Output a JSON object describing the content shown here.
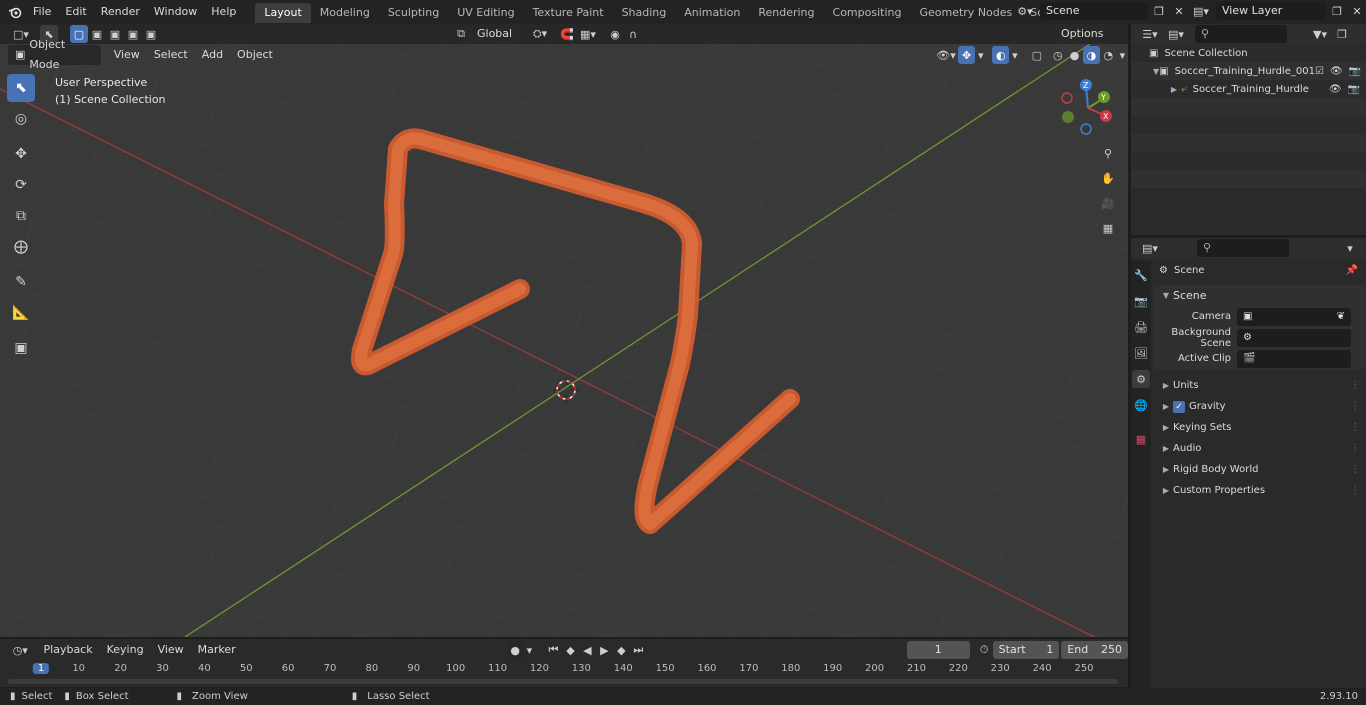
{
  "topbar": {
    "menus": [
      "File",
      "Edit",
      "Render",
      "Window",
      "Help"
    ],
    "workspaces": [
      "Layout",
      "Modeling",
      "Sculpting",
      "UV Editing",
      "Texture Paint",
      "Shading",
      "Animation",
      "Rendering",
      "Compositing",
      "Geometry Nodes",
      "Scripting"
    ],
    "active_workspace": "Layout",
    "scene_name": "Scene",
    "view_layer": "View Layer"
  },
  "viewport_header": {
    "transform_orientation": "Global",
    "options_label": "Options",
    "mode": "Object Mode",
    "menus": [
      "View",
      "Select",
      "Add",
      "Object"
    ]
  },
  "viewport": {
    "perspective_label": "User Perspective",
    "collection_label": "(1) Scene Collection",
    "gizmo": {
      "x": "X",
      "y": "Y",
      "z": "Z"
    }
  },
  "outliner": {
    "items": [
      {
        "label": "Scene Collection"
      },
      {
        "label": "Soccer_Training_Hurdle_001"
      },
      {
        "label": "Soccer_Training_Hurdle"
      }
    ]
  },
  "properties": {
    "context_title": "Scene",
    "section_title": "Scene",
    "fields": [
      {
        "label": "Camera"
      },
      {
        "label": "Background Scene"
      },
      {
        "label": "Active Clip"
      }
    ],
    "panels": [
      "Units",
      "Gravity",
      "Keying Sets",
      "Audio",
      "Rigid Body World",
      "Custom Properties"
    ]
  },
  "timeline": {
    "menus": [
      "Playback",
      "Keying",
      "View",
      "Marker"
    ],
    "current_frame": "1",
    "start_label": "Start",
    "start_value": "1",
    "end_label": "End",
    "end_value": "250",
    "ruler": [
      "1",
      "10",
      "20",
      "30",
      "40",
      "50",
      "60",
      "70",
      "80",
      "90",
      "100",
      "110",
      "120",
      "130",
      "140",
      "150",
      "160",
      "170",
      "180",
      "190",
      "200",
      "210",
      "220",
      "230",
      "240",
      "250"
    ]
  },
  "statusbar": {
    "items": [
      "Select",
      "Box Select",
      "Zoom View",
      "Lasso Select"
    ],
    "version": "2.93.10"
  },
  "colors": {
    "accent": "#4772b3",
    "object": "#d9673a",
    "x_axis": "#9b3b3b",
    "y_axis": "#6b9a2c"
  }
}
